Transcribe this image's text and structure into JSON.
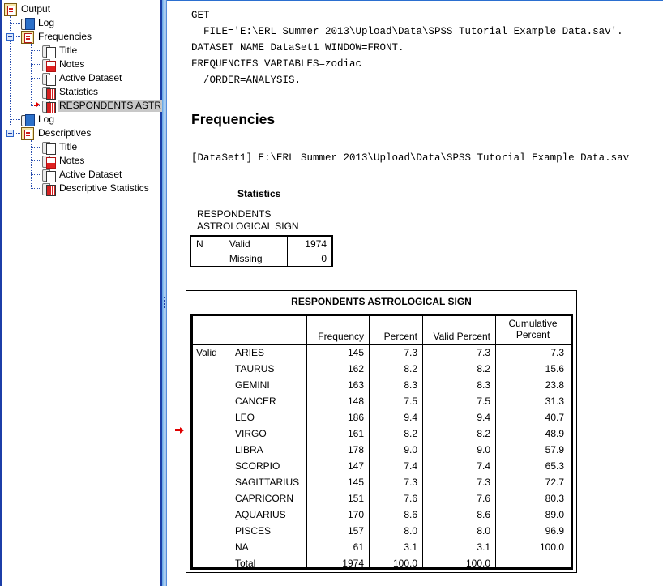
{
  "nav": {
    "items": [
      {
        "label": "Output",
        "icon": "output-book-icon",
        "level": 0
      },
      {
        "label": "Log",
        "icon": "log-icon",
        "level": 1
      },
      {
        "label": "Frequencies",
        "icon": "output-book-icon",
        "level": 1,
        "expanded": true
      },
      {
        "label": "Title",
        "icon": "title-icon",
        "level": 2
      },
      {
        "label": "Notes",
        "icon": "notes-icon",
        "level": 2
      },
      {
        "label": "Active Dataset",
        "icon": "page-icon",
        "level": 2
      },
      {
        "label": "Statistics",
        "icon": "table-icon",
        "level": 2
      },
      {
        "label": "RESPONDENTS ASTROLOGICAL SIGN",
        "display": "RESPONDENTS ASTR",
        "icon": "table-icon",
        "level": 2,
        "selected": true
      },
      {
        "label": "Log",
        "icon": "log-icon",
        "level": 1
      },
      {
        "label": "Descriptives",
        "icon": "output-book-icon",
        "level": 1,
        "expanded": true
      },
      {
        "label": "Title",
        "icon": "title-icon",
        "level": 2
      },
      {
        "label": "Notes",
        "icon": "notes-icon",
        "level": 2
      },
      {
        "label": "Active Dataset",
        "icon": "page-icon",
        "level": 2
      },
      {
        "label": "Descriptive Statistics",
        "icon": "table-icon",
        "level": 2
      }
    ]
  },
  "syntax": [
    "GET",
    "  FILE='E:\\ERL Summer 2013\\Upload\\Data\\SPSS Tutorial Example Data.sav'.",
    "DATASET NAME DataSet1 WINDOW=FRONT.",
    "FREQUENCIES VARIABLES=zodiac",
    "  /ORDER=ANALYSIS."
  ],
  "heading": "Frequencies",
  "dataset_line": "[DataSet1] E:\\ERL Summer 2013\\Upload\\Data\\SPSS Tutorial Example Data.sav",
  "statistics": {
    "title": "Statistics",
    "variable_line1": "RESPONDENTS",
    "variable_line2": "ASTROLOGICAL SIGN",
    "rows": [
      {
        "c1": "N",
        "c2": "Valid",
        "value": "1974"
      },
      {
        "c1": "",
        "c2": "Missing",
        "value": "0"
      }
    ]
  },
  "frequency_table": {
    "title": "RESPONDENTS ASTROLOGICAL SIGN",
    "headers": {
      "frequency": "Frequency",
      "percent": "Percent",
      "valid_percent": "Valid Percent",
      "cumulative_1": "Cumulative",
      "cumulative_2": "Percent"
    },
    "group_label": "Valid",
    "rows": [
      {
        "label": "ARIES",
        "frequency": "145",
        "percent": "7.3",
        "valid_percent": "7.3",
        "cumulative": "7.3"
      },
      {
        "label": "TAURUS",
        "frequency": "162",
        "percent": "8.2",
        "valid_percent": "8.2",
        "cumulative": "15.6"
      },
      {
        "label": "GEMINI",
        "frequency": "163",
        "percent": "8.3",
        "valid_percent": "8.3",
        "cumulative": "23.8"
      },
      {
        "label": "CANCER",
        "frequency": "148",
        "percent": "7.5",
        "valid_percent": "7.5",
        "cumulative": "31.3"
      },
      {
        "label": "LEO",
        "frequency": "186",
        "percent": "9.4",
        "valid_percent": "9.4",
        "cumulative": "40.7"
      },
      {
        "label": "VIRGO",
        "frequency": "161",
        "percent": "8.2",
        "valid_percent": "8.2",
        "cumulative": "48.9"
      },
      {
        "label": "LIBRA",
        "frequency": "178",
        "percent": "9.0",
        "valid_percent": "9.0",
        "cumulative": "57.9"
      },
      {
        "label": "SCORPIO",
        "frequency": "147",
        "percent": "7.4",
        "valid_percent": "7.4",
        "cumulative": "65.3"
      },
      {
        "label": "SAGITTARIUS",
        "frequency": "145",
        "percent": "7.3",
        "valid_percent": "7.3",
        "cumulative": "72.7"
      },
      {
        "label": "CAPRICORN",
        "frequency": "151",
        "percent": "7.6",
        "valid_percent": "7.6",
        "cumulative": "80.3"
      },
      {
        "label": "AQUARIUS",
        "frequency": "170",
        "percent": "8.6",
        "valid_percent": "8.6",
        "cumulative": "89.0"
      },
      {
        "label": "PISCES",
        "frequency": "157",
        "percent": "8.0",
        "valid_percent": "8.0",
        "cumulative": "96.9"
      },
      {
        "label": "NA",
        "frequency": "61",
        "percent": "3.1",
        "valid_percent": "3.1",
        "cumulative": "100.0"
      },
      {
        "label": "Total",
        "frequency": "1974",
        "percent": "100.0",
        "valid_percent": "100.0",
        "cumulative": ""
      }
    ]
  },
  "colors": {
    "nav_border": "#1c3ea8",
    "selection": "#c8c8c8",
    "current_item_arrow": "#e00000"
  }
}
